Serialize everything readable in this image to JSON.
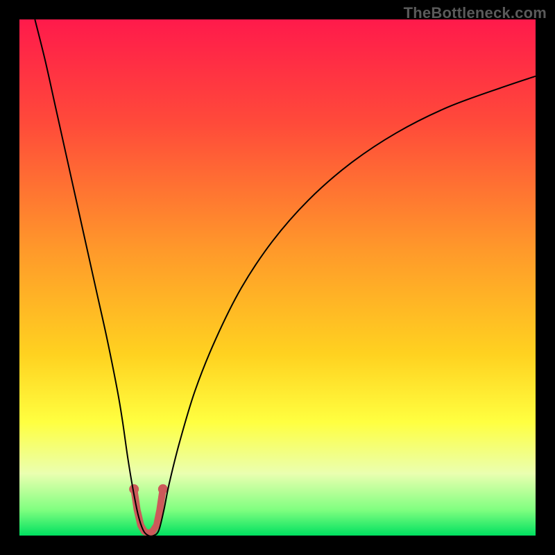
{
  "watermark": "TheBottleneck.com",
  "chart_data": {
    "type": "line",
    "title": "",
    "xlabel": "",
    "ylabel": "",
    "xlim": [
      0,
      100
    ],
    "ylim": [
      0,
      100
    ],
    "grid": false,
    "legend": false,
    "background_gradient": {
      "stops": [
        {
          "offset": 0.0,
          "color": "#ff1a4b"
        },
        {
          "offset": 0.2,
          "color": "#ff4a3a"
        },
        {
          "offset": 0.45,
          "color": "#ff9a2a"
        },
        {
          "offset": 0.65,
          "color": "#ffd220"
        },
        {
          "offset": 0.78,
          "color": "#ffff40"
        },
        {
          "offset": 0.88,
          "color": "#eaffb0"
        },
        {
          "offset": 0.95,
          "color": "#80ff80"
        },
        {
          "offset": 1.0,
          "color": "#00e060"
        }
      ]
    },
    "series": [
      {
        "name": "bottleneck-curve",
        "color": "#000000",
        "x": [
          3,
          5,
          7,
          9,
          11,
          13,
          15,
          17,
          19,
          20,
          21,
          22,
          23,
          24,
          25,
          26,
          27,
          28,
          29,
          31,
          34,
          38,
          43,
          49,
          56,
          64,
          73,
          83,
          94,
          100
        ],
        "y": [
          100,
          92,
          83,
          74,
          65,
          56,
          47,
          38,
          28,
          22,
          15,
          9,
          4,
          1,
          0,
          0,
          1,
          5,
          10,
          18,
          28,
          38,
          48,
          57,
          65,
          72,
          78,
          83,
          87,
          89
        ]
      },
      {
        "name": "highlight-segment",
        "color": "#cc5a5a",
        "stroke_width": 10,
        "points_x": [
          22.2,
          22.8,
          23.5,
          24.2,
          25.0,
          25.8,
          26.6,
          27.2,
          27.8
        ],
        "points_y": [
          9.0,
          5.0,
          2.0,
          0.8,
          0.4,
          0.8,
          2.0,
          5.0,
          9.0
        ]
      }
    ],
    "annotations": []
  }
}
